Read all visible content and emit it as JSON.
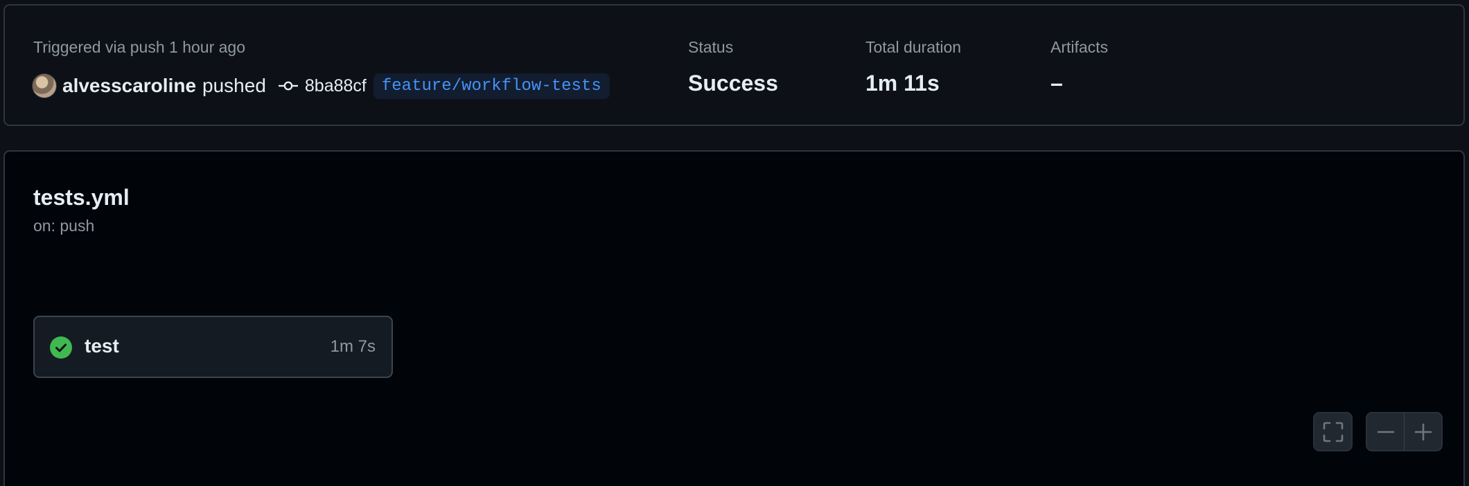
{
  "summary": {
    "trigger_text": "Triggered via push 1 hour ago",
    "actor": "alvesscaroline",
    "action": "pushed",
    "commit_sha": "8ba88cf",
    "branch": "feature/workflow-tests",
    "status_label": "Status",
    "status_value": "Success",
    "duration_label": "Total duration",
    "duration_value": "1m 11s",
    "artifacts_label": "Artifacts",
    "artifacts_value": "–"
  },
  "workflow": {
    "file_name": "tests.yml",
    "trigger": "on: push",
    "jobs": [
      {
        "name": "test",
        "duration": "1m 7s",
        "status": "success",
        "status_icon": "check-circle-fill-icon"
      }
    ]
  },
  "controls": {
    "fullscreen_icon": "fullscreen-icon",
    "zoom_out_icon": "minus-icon",
    "zoom_in_icon": "plus-icon"
  },
  "colors": {
    "page_bg": "#0d1117",
    "graph_bg": "#010409",
    "border": "#30363d",
    "text_primary": "#e6edf3",
    "text_muted": "#9198a1",
    "link_blue": "#4493f8",
    "success_green": "#3fb950"
  }
}
